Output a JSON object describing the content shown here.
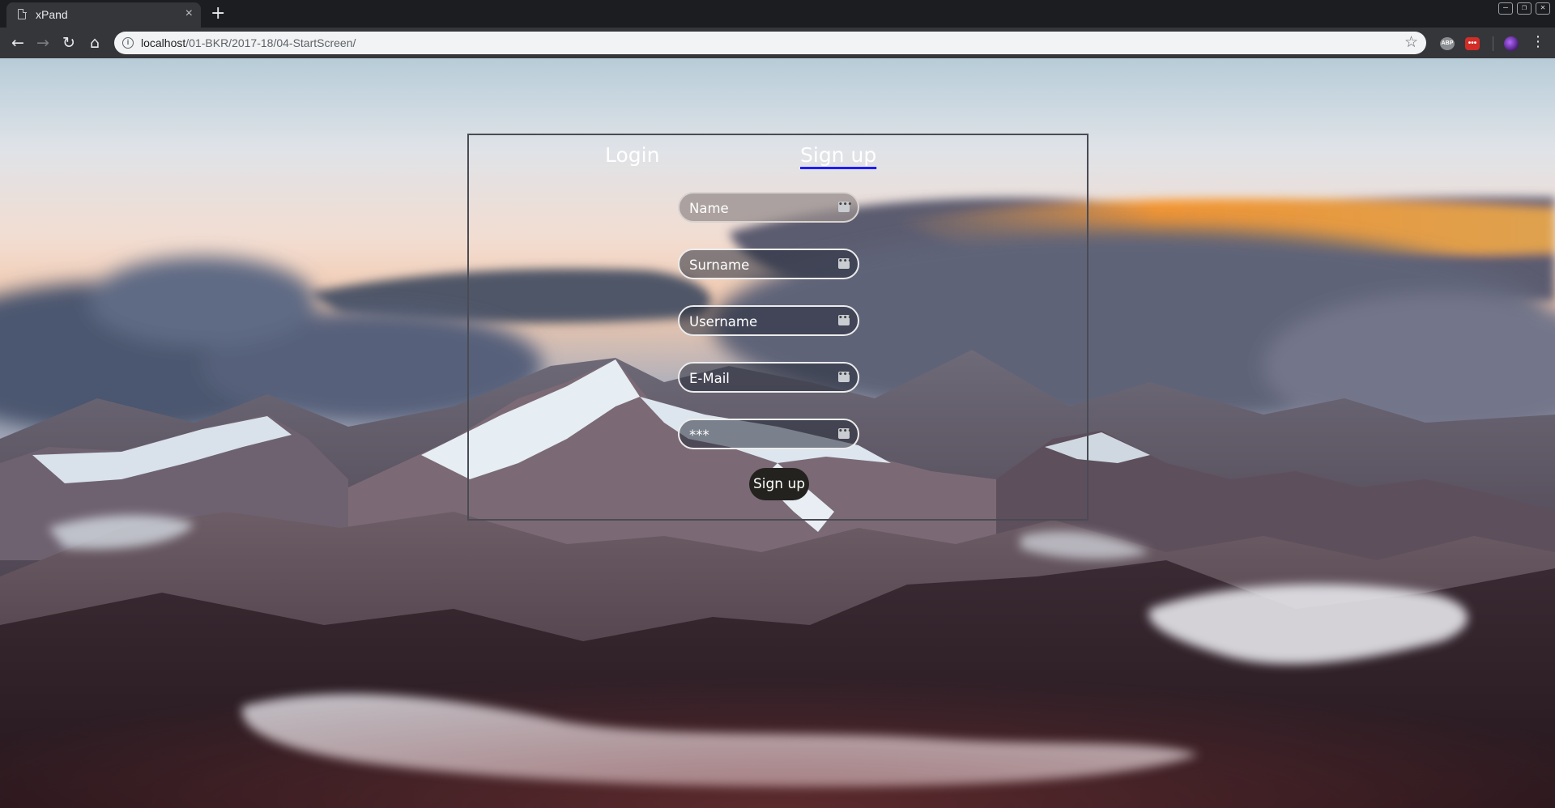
{
  "browser": {
    "tab_title": "xPand",
    "tab_close": "×",
    "new_tab": "+",
    "url_host": "localhost",
    "url_path": "/01-BKR/2017-18/04-StartScreen/",
    "icons": [
      "page-icon",
      "close-icon",
      "plus-icon",
      "back-icon",
      "forward-icon",
      "reload-icon",
      "home-icon",
      "info-icon",
      "star-icon",
      "adblock-icon",
      "lastpass-icon",
      "profile-icon",
      "menu-icon",
      "minimize-icon",
      "restore-icon",
      "close-window-icon"
    ],
    "ext_abp": "ABP",
    "ext_lp": "•••",
    "window_controls": {
      "minimize": "—",
      "restore": "❐",
      "close": "✕"
    }
  },
  "auth": {
    "tabs": {
      "login": "Login",
      "signup": "Sign up"
    },
    "active_tab": "signup",
    "fields": {
      "name_placeholder": "Name",
      "surname_placeholder": "Surname",
      "username_placeholder": "Username",
      "email_placeholder": "E-Mail",
      "password_placeholder": "***"
    },
    "password_manager_icon": "•••",
    "submit_label": "Sign up"
  },
  "colors": {
    "active_tab_underline": "#1d1dff",
    "panel_border": "#4a4b54",
    "submit_bg": "#23221f"
  }
}
